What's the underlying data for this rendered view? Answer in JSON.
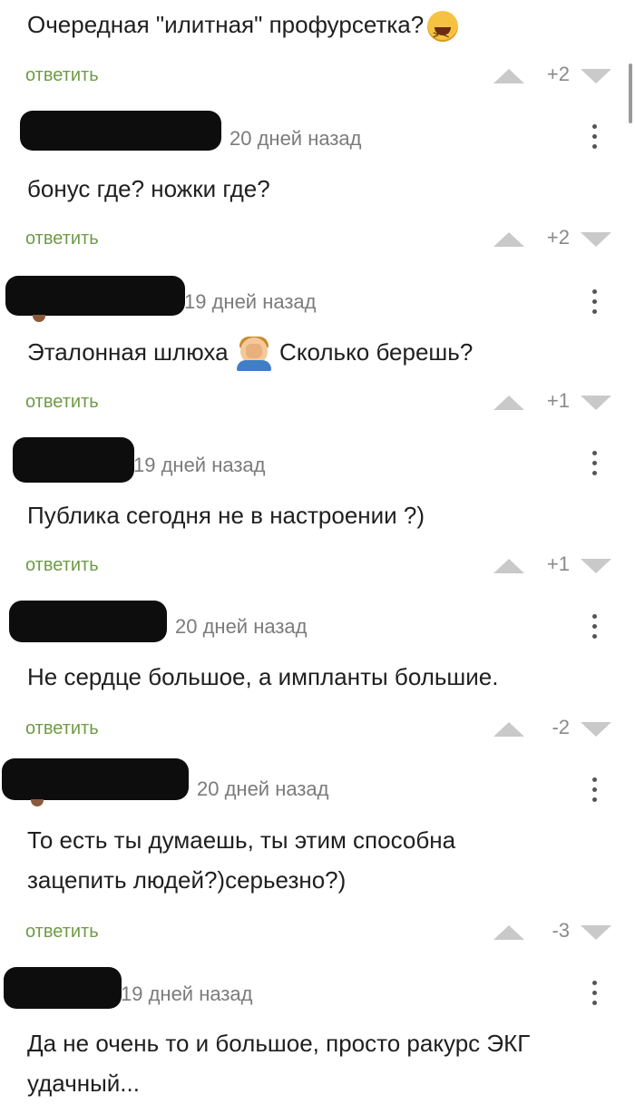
{
  "reply_label": "ответить",
  "comments": [
    {
      "text": "Очередная \"илитная\" профурсетка?",
      "emoji": "grinning-squinting-face",
      "score": "+2"
    },
    {
      "date": "20 дней назад",
      "text": "бонус где? ножки где?",
      "score": "+2"
    },
    {
      "date": "19 дней назад",
      "text_before": "Эталонная шлюха",
      "emoji": "face-palm",
      "text_after": "Сколько берешь?",
      "score": "+1"
    },
    {
      "date": "19 дней назад",
      "text": "Публика сегодня не в настроении ?)",
      "score": "+1"
    },
    {
      "date": "20 дней назад",
      "text": "Не сердце большое, а импланты большие.",
      "score": "-2"
    },
    {
      "date": "20 дней назад",
      "text": "То есть ты думаешь, ты этим способна\nзацепить людей?)серьезно?)",
      "score": "-3"
    },
    {
      "date": "19 дней назад",
      "text": "Да не очень то и большое, просто ракурс ЭКГ\nудачный..."
    }
  ],
  "colors": {
    "reply": "#6f9b45",
    "vote_arrow": "#c9c9c9",
    "score": "#8a8a8a",
    "date": "#7b7b7b",
    "redaction": "#0d0d0d"
  },
  "icons": {
    "upvote": "triangle-up-icon",
    "downvote": "triangle-down-icon",
    "menu": "kebab-menu-icon"
  }
}
